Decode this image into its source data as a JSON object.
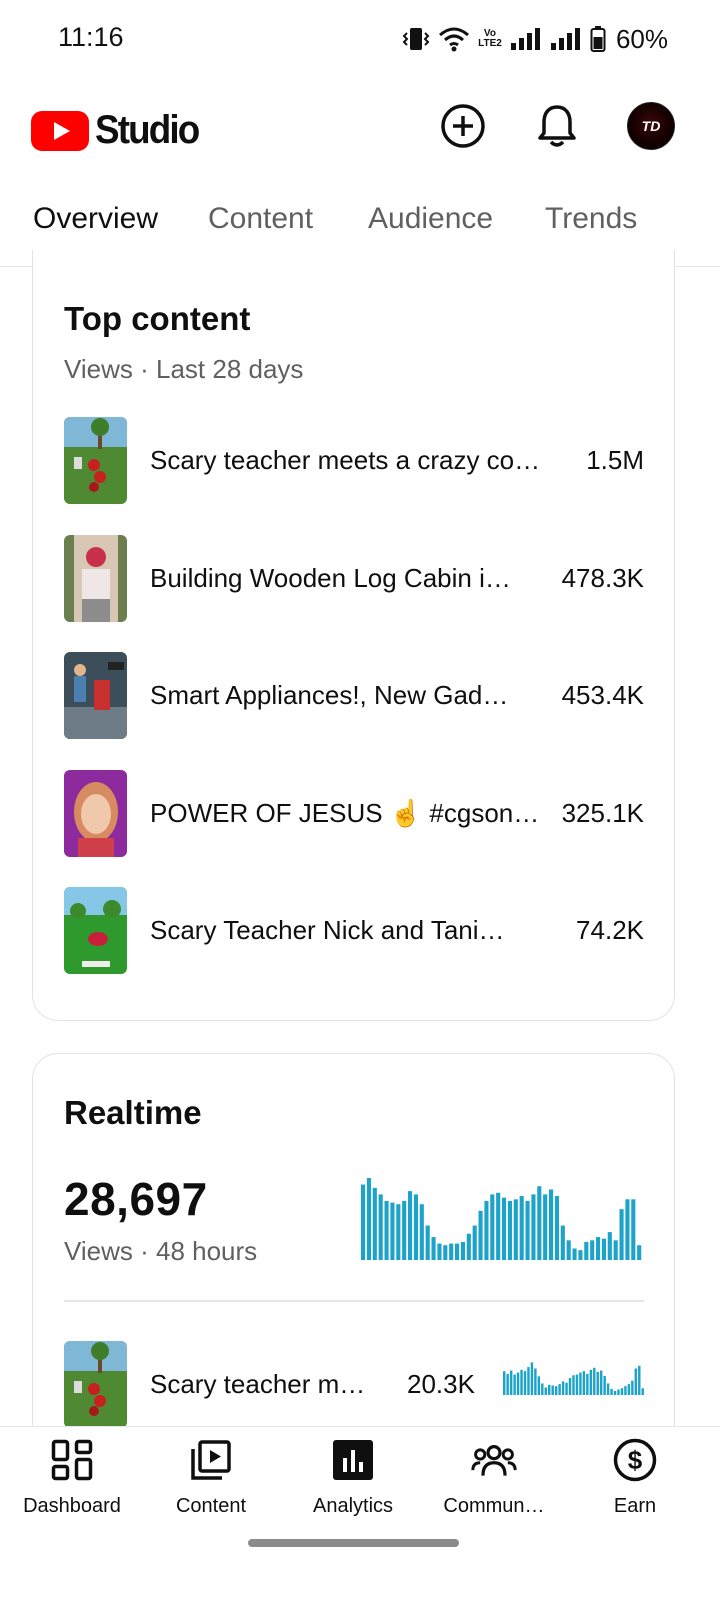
{
  "status_bar": {
    "time": "11:16",
    "battery": "60%",
    "network": "Vo LTE2",
    "icons": [
      "vibrate-icon",
      "wifi-icon",
      "volte-icon",
      "signal-icon",
      "signal-icon",
      "battery-icon"
    ]
  },
  "header": {
    "logo_text": "Studio",
    "icons": [
      "create-icon",
      "notifications-icon",
      "avatar"
    ],
    "avatar_text": "TD"
  },
  "tabs": [
    {
      "label": "Overview",
      "active": true
    },
    {
      "label": "Content",
      "active": false
    },
    {
      "label": "Audience",
      "active": false
    },
    {
      "label": "Trends",
      "active": false
    }
  ],
  "top_content": {
    "title": "Top content",
    "subtitle": "Views · Last 28 days",
    "items": [
      {
        "title": "Scary teacher meets a crazy co…",
        "value": "1.5M"
      },
      {
        "title": "Building Wooden Log Cabin i…",
        "value": "478.3K"
      },
      {
        "title": "Smart Appliances!, New Gad…",
        "value": "453.4K"
      },
      {
        "title": "POWER OF JESUS ☝️ #cgson…",
        "value": "325.1K"
      },
      {
        "title": "Scary Teacher Nick and Tani…",
        "value": "74.2K"
      }
    ]
  },
  "realtime": {
    "title": "Realtime",
    "views": "28,697",
    "subtitle": "Views · 48 hours",
    "bar_levels": [
      0.92,
      1.0,
      0.88,
      0.8,
      0.72,
      0.7,
      0.68,
      0.72,
      0.84,
      0.8,
      0.68,
      0.42,
      0.28,
      0.2,
      0.18,
      0.2,
      0.2,
      0.22,
      0.32,
      0.42,
      0.6,
      0.72,
      0.8,
      0.82,
      0.76,
      0.72,
      0.74,
      0.78,
      0.72,
      0.8,
      0.9,
      0.8,
      0.86,
      0.78,
      0.42,
      0.24,
      0.14,
      0.12,
      0.22,
      0.24,
      0.28,
      0.26,
      0.34,
      0.24,
      0.62,
      0.74,
      0.74,
      0.18
    ],
    "top_item": {
      "title": "Scary teacher m…",
      "value": "20.3K"
    },
    "mini_levels": [
      0.7,
      0.62,
      0.72,
      0.6,
      0.66,
      0.74,
      0.7,
      0.82,
      0.96,
      0.78,
      0.55,
      0.34,
      0.22,
      0.3,
      0.28,
      0.26,
      0.32,
      0.4,
      0.36,
      0.5,
      0.58,
      0.6,
      0.66,
      0.7,
      0.62,
      0.74,
      0.8,
      0.68,
      0.72,
      0.56,
      0.34,
      0.18,
      0.12,
      0.16,
      0.2,
      0.26,
      0.32,
      0.42,
      0.78,
      0.86,
      0.2
    ]
  },
  "bottom_nav": [
    {
      "label": "Dashboard",
      "icon": "dashboard-icon"
    },
    {
      "label": "Content",
      "icon": "content-icon"
    },
    {
      "label": "Analytics",
      "icon": "analytics-icon",
      "active": true
    },
    {
      "label": "Commun…",
      "icon": "community-icon"
    },
    {
      "label": "Earn",
      "icon": "earn-icon"
    }
  ],
  "colors": {
    "accent_red": "#ff0000",
    "bar_blue": "#1ba3c9",
    "text_primary": "#0f0f0f",
    "text_secondary": "#606060"
  }
}
